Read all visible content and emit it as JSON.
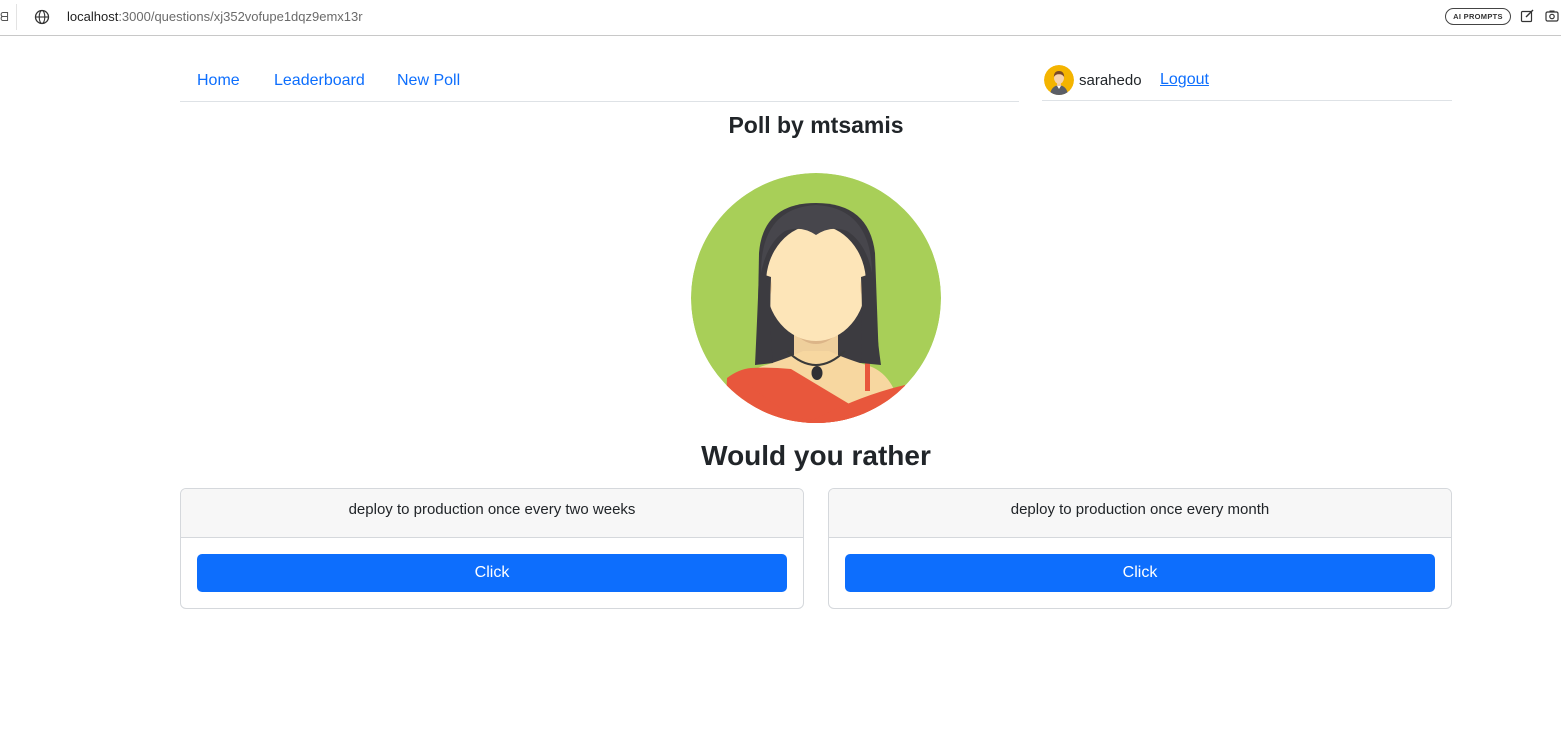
{
  "browser": {
    "url_host": "localhost",
    "url_path": ":3000/questions/xj352vofupe1dqz9emx13r",
    "ai_prompts_label": "AI PROMPTS",
    "icons": [
      "globe-icon",
      "edit-icon",
      "screenshot-icon"
    ]
  },
  "nav": {
    "links": [
      {
        "label": "Home"
      },
      {
        "label": "Leaderboard"
      },
      {
        "label": "New Poll"
      }
    ],
    "username": "sarahedo",
    "logout_label": "Logout"
  },
  "poll": {
    "title": "Poll by mtsamis",
    "question": "Would you rather",
    "options": [
      {
        "text": "deploy to production once every two weeks",
        "button_label": "Click"
      },
      {
        "text": "deploy to production once every month",
        "button_label": "Click"
      }
    ]
  },
  "colors": {
    "primary": "#0d6efd",
    "avatar_bg": "#a8cf58",
    "shirt": "#e8573c"
  }
}
